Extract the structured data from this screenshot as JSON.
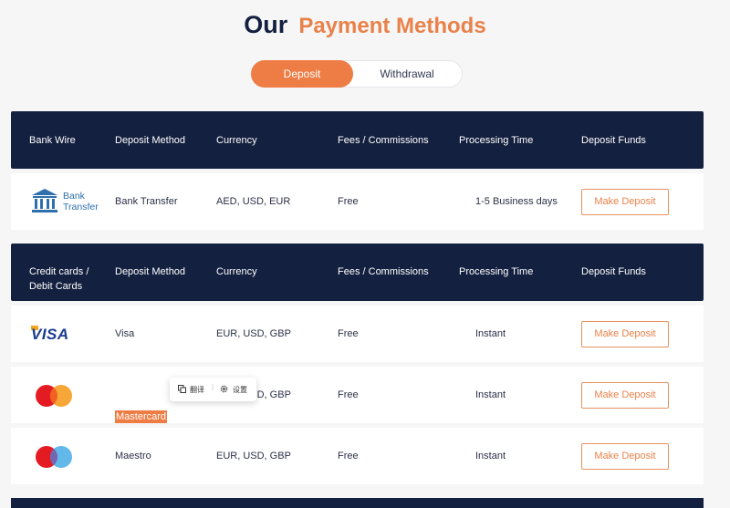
{
  "title": {
    "part1": "Our",
    "part2": "Payment Methods"
  },
  "tabs": {
    "deposit": "Deposit",
    "withdrawal": "Withdrawal"
  },
  "section_bank": {
    "headers": [
      "Bank Wire",
      "Deposit Method",
      "Currency",
      "Fees / Commissions",
      "Processing Time",
      "Deposit Funds"
    ],
    "row": {
      "logo_text": "Bank Transfer",
      "method": "Bank Transfer",
      "currency": "AED, USD, EUR",
      "fees": "Free",
      "time": "1-5 Business days",
      "button": "Make Deposit"
    }
  },
  "section_cards": {
    "headers": [
      "Credit cards / Debit Cards",
      "Deposit Method",
      "Currency",
      "Fees / Commissions",
      "Processing Time",
      "Deposit Funds"
    ],
    "rows": [
      {
        "logo_text": "VISA",
        "method": "Visa",
        "currency": "EUR, USD, GBP",
        "fees": "Free",
        "time": "Instant",
        "button": "Make Deposit"
      },
      {
        "method": "Mastercard",
        "currency": "EUR, USD, GBP",
        "fees": "Free",
        "time": "Instant",
        "button": "Make Deposit"
      },
      {
        "method": "Maestro",
        "currency": "EUR, USD, GBP",
        "fees": "Free",
        "time": "Instant",
        "button": "Make Deposit"
      }
    ]
  },
  "popup": {
    "translate": "翻译",
    "settings": "设置"
  },
  "colors": {
    "navy": "#14203f",
    "accent": "#ee7d45",
    "link_blue": "#2f6fae"
  },
  "icons": {
    "bank": "bank-building-icon",
    "copy": "copy-icon",
    "gear": "gear-icon"
  }
}
